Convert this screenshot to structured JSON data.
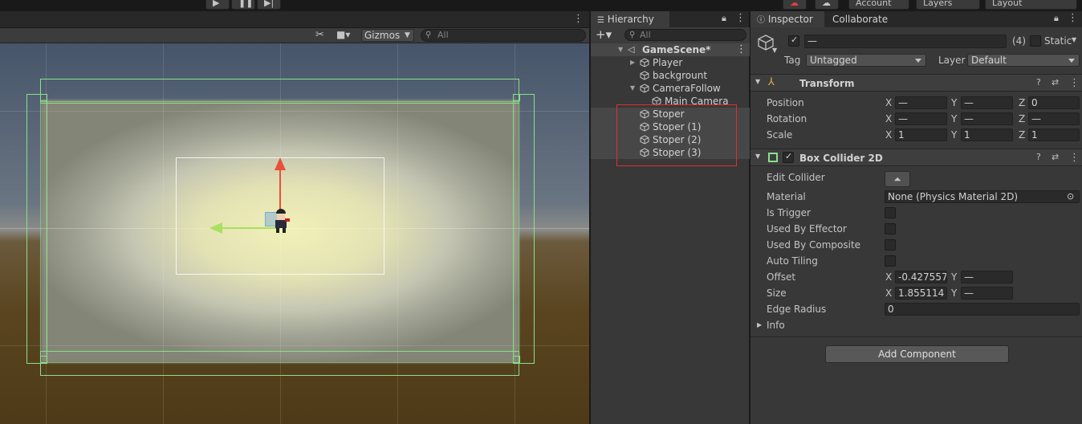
{
  "topbar": {
    "account": "Account",
    "layers": "Layers",
    "layout": "Layout"
  },
  "scene": {
    "gizmos_label": "Gizmos",
    "search_placeholder": "All"
  },
  "hierarchy": {
    "tab_label": "Hierarchy",
    "search_placeholder": "All",
    "scene_name": "GameScene*",
    "items": [
      {
        "label": "Player"
      },
      {
        "label": "backgrount"
      },
      {
        "label": "CameraFollow"
      },
      {
        "label": "Main Camera"
      },
      {
        "label": "Stoper"
      },
      {
        "label": "Stoper (1)"
      },
      {
        "label": "Stoper (2)"
      },
      {
        "label": "Stoper (3)"
      }
    ]
  },
  "inspector": {
    "tab_label": "Inspector",
    "collaborate_tab": "Collaborate",
    "name_value": "—",
    "count": "(4)",
    "static_label": "Static",
    "tag_label": "Tag",
    "tag_value": "Untagged",
    "layer_label": "Layer",
    "layer_value": "Default",
    "transform": {
      "title": "Transform",
      "position_label": "Position",
      "rotation_label": "Rotation",
      "scale_label": "Scale",
      "position": {
        "x": "—",
        "y": "—",
        "z": "0"
      },
      "rotation": {
        "x": "—",
        "y": "—",
        "z": "—"
      },
      "scale": {
        "x": "1",
        "y": "1",
        "z": "1"
      }
    },
    "axis": {
      "x": "X",
      "y": "Y",
      "z": "Z"
    },
    "box_collider": {
      "title": "Box Collider 2D",
      "edit_collider_label": "Edit Collider",
      "material_label": "Material",
      "material_value": "None (Physics Material 2D)",
      "is_trigger_label": "Is Trigger",
      "used_by_effector_label": "Used By Effector",
      "used_by_composite_label": "Used By Composite",
      "auto_tiling_label": "Auto Tiling",
      "offset_label": "Offset",
      "offset": {
        "x": "-0.427557",
        "y": "—"
      },
      "size_label": "Size",
      "size": {
        "x": "1.855114",
        "y": "—"
      },
      "edge_radius_label": "Edge Radius",
      "edge_radius_value": "0",
      "info_label": "Info"
    },
    "add_component_label": "Add Component"
  },
  "colors": {
    "selection_box": "#e03030",
    "collider": "#8ae08a",
    "gizmo_y": "#e8503a",
    "gizmo_x": "#a8e060"
  }
}
